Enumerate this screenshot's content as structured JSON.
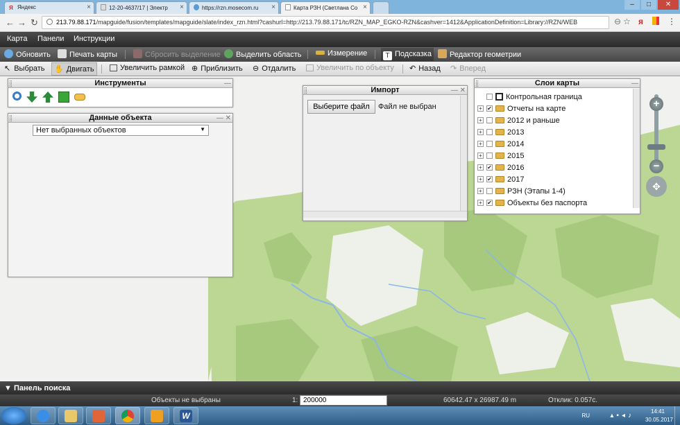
{
  "browser": {
    "tabs": [
      {
        "title": "Яндекс",
        "active": false
      },
      {
        "title": "12-20-4637/17 | Электр",
        "active": false
      },
      {
        "title": "https://rzn.mosecom.ru",
        "active": false
      },
      {
        "title": "Карта РЗН (Светлана Со",
        "active": true
      }
    ],
    "url_host": "213.79.88.171",
    "url_path": "/mapguide/fusion/templates/mapguide/slate/index_rzn.html?cashurl=http://213.79.88.171/tc/RZN_MAP_EGKO-RZN&cashver=1412&ApplicationDefinition=Library://RZN/WEB"
  },
  "menu": {
    "items": [
      "Карта",
      "Панели",
      "Инструкции"
    ]
  },
  "toolbar1": {
    "refresh": "Обновить",
    "print": "Печать карты",
    "reset_selection": "Сбросить выделение",
    "select_area": "Выделить область",
    "measure": "Измерение",
    "hint": "Подсказка",
    "geometry_editor": "Редактор геометрии"
  },
  "toolbar2": {
    "select": "Выбрать",
    "pan": "Двигать",
    "zoom_rect": "Увеличить рамкой",
    "zoom_in": "Приблизить",
    "zoom_out": "Отдалить",
    "zoom_object": "Увеличить по объекту",
    "back": "Назад",
    "forward": "Вперед"
  },
  "panels": {
    "tools_title": "Инструменты",
    "object_title": "Данные объекта",
    "object_select_value": "Нет выбранных объектов",
    "import_title": "Импорт",
    "choose_file": "Выберите файл",
    "no_file": "Файл не выбран",
    "layers_title": "Слои карты"
  },
  "layers": [
    {
      "label": "Контрольная граница",
      "expandable": false,
      "checked": false,
      "folder": false
    },
    {
      "label": "Отчеты на карте",
      "expandable": true,
      "checked": true,
      "folder": true
    },
    {
      "label": "2012 и раньше",
      "expandable": true,
      "checked": false,
      "folder": true
    },
    {
      "label": "2013",
      "expandable": true,
      "checked": false,
      "folder": true
    },
    {
      "label": "2014",
      "expandable": true,
      "checked": false,
      "folder": true
    },
    {
      "label": "2015",
      "expandable": true,
      "checked": false,
      "folder": true
    },
    {
      "label": "2016",
      "expandable": true,
      "checked": true,
      "folder": true
    },
    {
      "label": "2017",
      "expandable": true,
      "checked": true,
      "folder": true
    },
    {
      "label": "РЗН (Этапы 1-4)",
      "expandable": true,
      "checked": false,
      "folder": true
    },
    {
      "label": "Объекты без паспорта",
      "expandable": true,
      "checked": true,
      "folder": true
    }
  ],
  "search_panel": "Панель поиска",
  "status": {
    "selection": "Объекты не выбраны",
    "scale_prefix": "1:",
    "scale": "200000",
    "coords": "60642.47 x 26987.49 m",
    "response": "Отклик: 0.057с."
  },
  "tray": {
    "lang": "RU",
    "time": "14:41",
    "date": "30.05.2017"
  },
  "colors": {
    "map_green": "#b9d593",
    "map_dark_green": "#a6c87d",
    "river": "#8cb6e6",
    "toolbar_dark": "#4a4a4a"
  }
}
